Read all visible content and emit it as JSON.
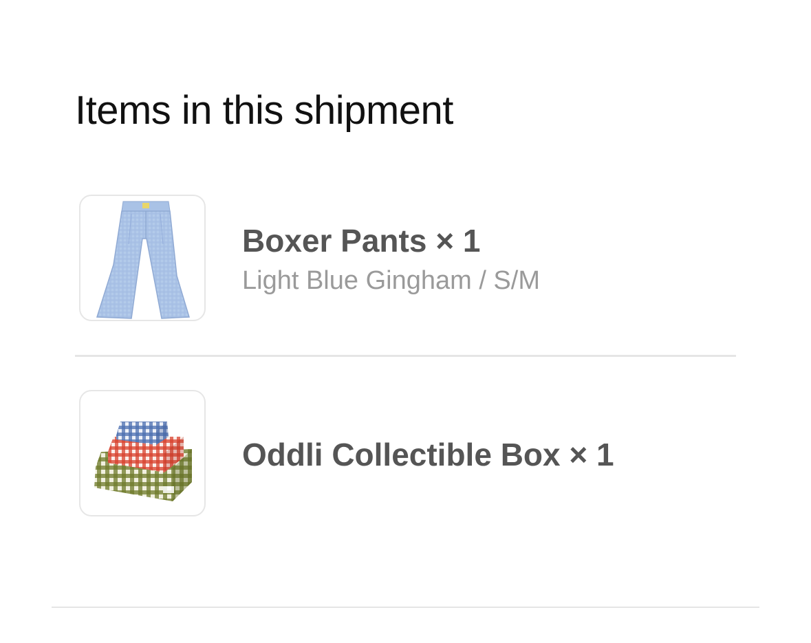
{
  "shipment": {
    "heading": "Items in this shipment",
    "items": [
      {
        "title": "Boxer Pants × 1",
        "variant": "Light Blue Gingham / S/M",
        "image_icon": "boxer-pants-image",
        "color": "#a9c4e6"
      },
      {
        "title": "Oddli Collectible Box × 1",
        "variant": "",
        "image_icon": "collectible-boxes-image",
        "colors": [
          "#6f7a2b",
          "#d8412d",
          "#4a6fb0"
        ]
      }
    ]
  },
  "colors": {
    "title_text": "#555555",
    "variant_text": "#9a9a9a",
    "divider": "#e5e5e5",
    "thumbnail_border": "#e6e6e6"
  }
}
